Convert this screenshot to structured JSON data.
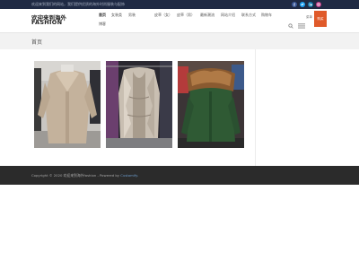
{
  "topbar": {
    "text": "欢迎来到我们的网站，我们提供优质的海外时尚服装与配饰",
    "social": [
      {
        "name": "facebook-icon",
        "color": "#3b5998",
        "glyph": "f"
      },
      {
        "name": "twitter-icon",
        "color": "#1da1f2",
        "glyph": "t"
      },
      {
        "name": "linkedin-icon",
        "color": "#0e76a8",
        "glyph": "in"
      },
      {
        "name": "instagram-icon",
        "color": "#c13584",
        "glyph": "◎"
      }
    ]
  },
  "header": {
    "logo_line1": "欢迎来到海外",
    "logo_line2": "FASHION",
    "nav": [
      {
        "label": "首页",
        "active": true
      },
      {
        "label": "女装类"
      },
      {
        "label": "男装"
      },
      {
        "label": "皮草（女）"
      },
      {
        "label": "皮草（男）"
      },
      {
        "label": "最新潮流"
      },
      {
        "label": "网站介绍"
      },
      {
        "label": "联系方式"
      },
      {
        "label": "购物车"
      },
      {
        "label": "博客"
      }
    ],
    "menu_label": "菜单",
    "cta_label": "购买"
  },
  "page": {
    "title": "首页"
  },
  "footer": {
    "copyright_prefix": "Copyright © 2020 欢迎来到海外fashion - Powered by",
    "copyright_link": "Customify."
  },
  "colors": {
    "topbar": "#1f2a44",
    "accent": "#e05a2a",
    "footer": "#2b2b2b"
  }
}
